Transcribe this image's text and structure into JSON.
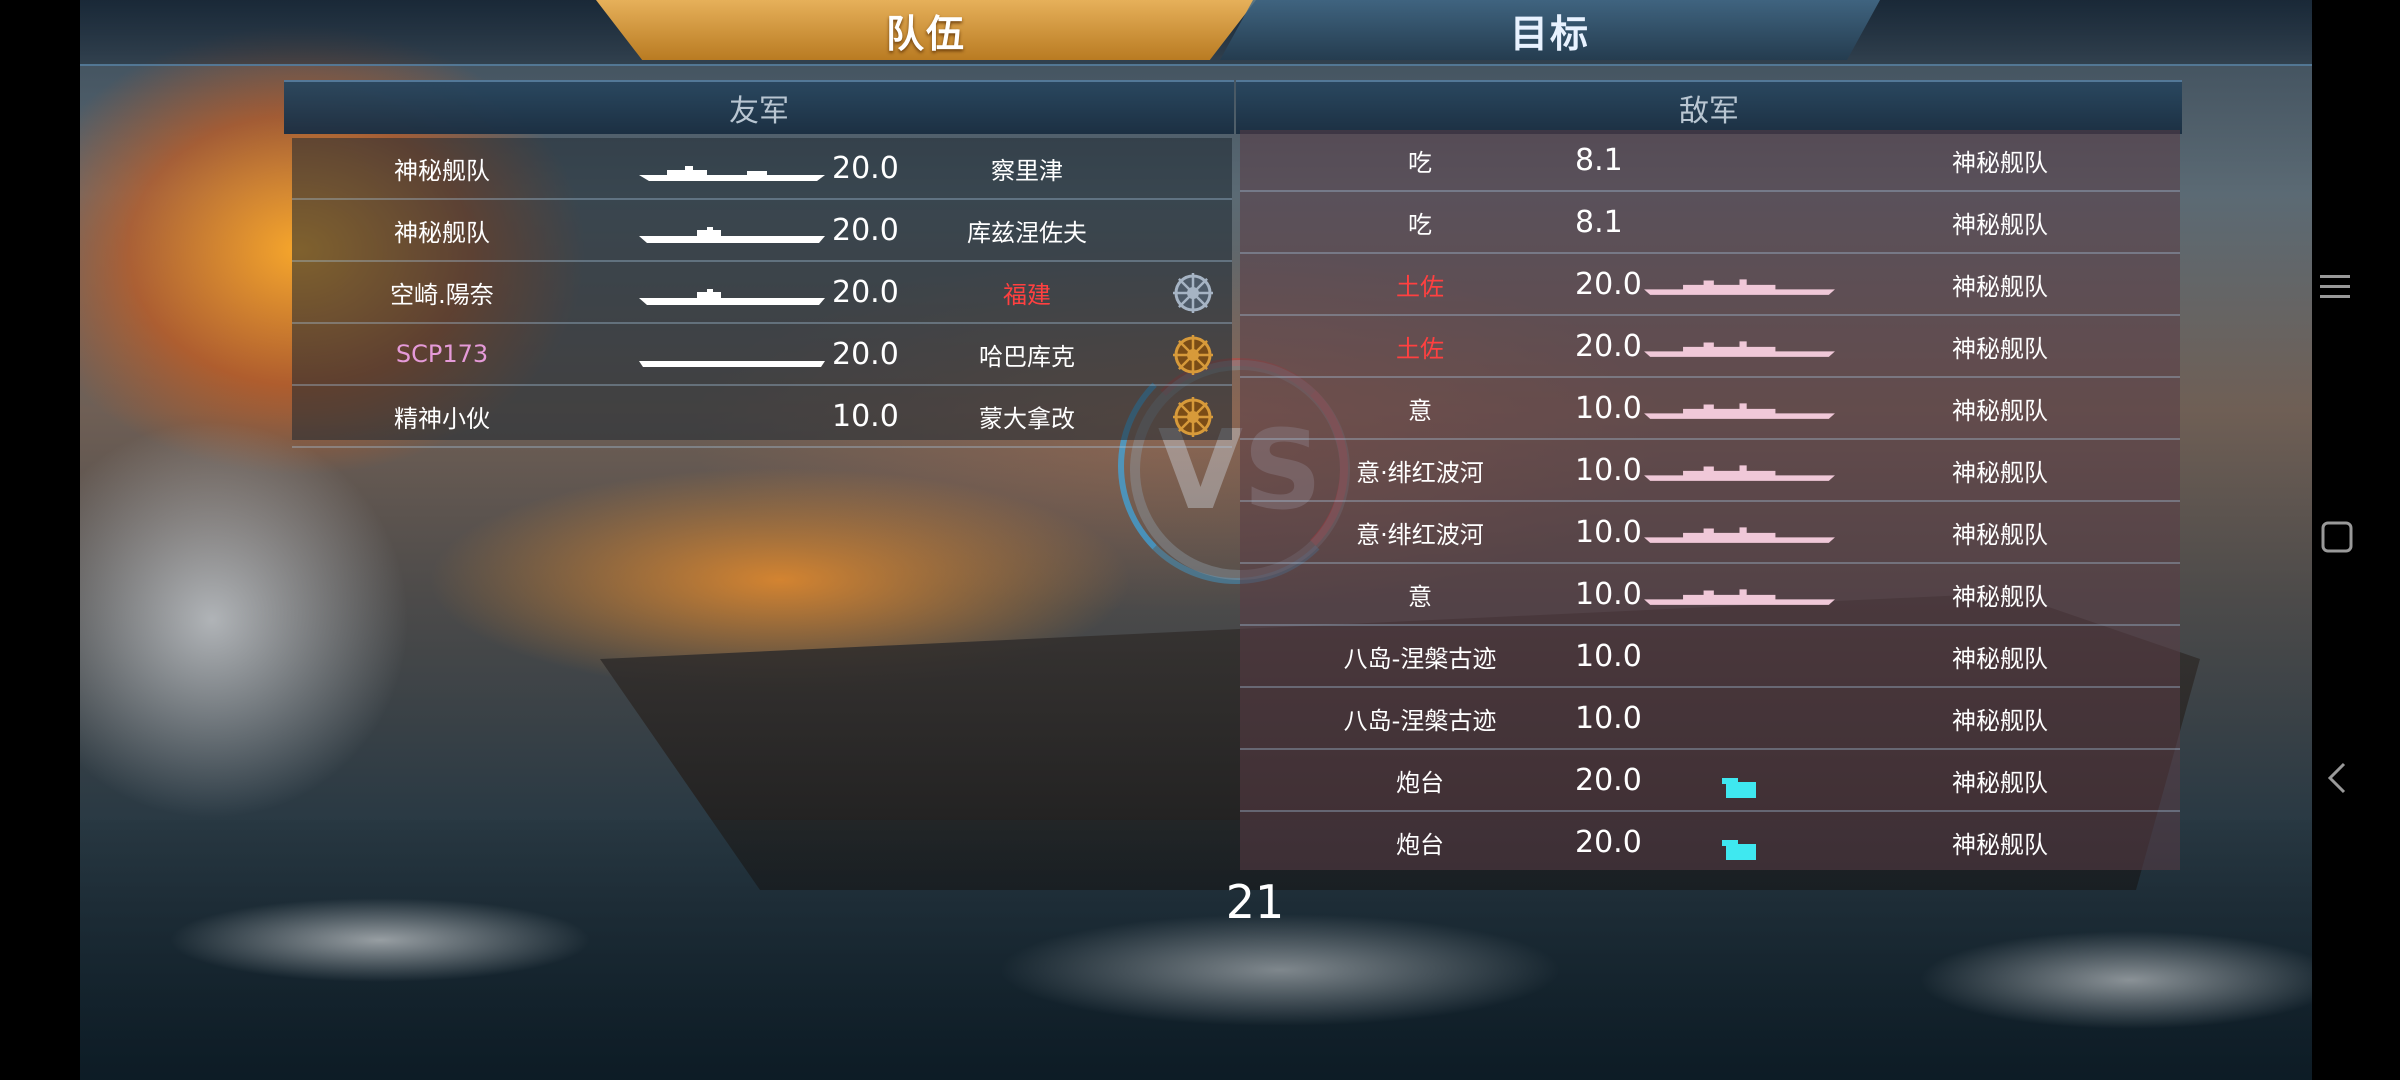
{
  "tabs": {
    "team": "队伍",
    "target": "目标"
  },
  "friendly": {
    "header": "友军",
    "rows": [
      {
        "name": "神秘舰队",
        "name_color": "#ffffff",
        "score": "20.0",
        "captain": "察里津",
        "captain_color": "#ffffff",
        "ship_icon": "destroyer-silhouette",
        "wheel": ""
      },
      {
        "name": "神秘舰队",
        "name_color": "#ffffff",
        "score": "20.0",
        "captain": "库兹涅佐夫",
        "captain_color": "#ffffff",
        "ship_icon": "carrier-silhouette",
        "wheel": ""
      },
      {
        "name": "空崎.陽奈",
        "name_color": "#ffffff",
        "score": "20.0",
        "captain": "福建",
        "captain_color": "#ff4040",
        "ship_icon": "carrier-silhouette",
        "wheel": "silver"
      },
      {
        "name": "SCP173",
        "name_color": "#e59ad8",
        "score": "20.0",
        "captain": "哈巴库克",
        "captain_color": "#ffffff",
        "ship_icon": "flat-carrier-silhouette",
        "wheel": "gold"
      },
      {
        "name": "精神小伙",
        "name_color": "#ffffff",
        "score": "10.0",
        "captain": "蒙大拿改",
        "captain_color": "#ffffff",
        "ship_icon": "",
        "wheel": "gold"
      }
    ]
  },
  "enemy": {
    "header": "敌军",
    "rows": [
      {
        "name": "吃",
        "name_color": "#ffffff",
        "score": "8.1",
        "fleet": "神秘舰队",
        "ship_icon": ""
      },
      {
        "name": "吃",
        "name_color": "#ffffff",
        "score": "8.1",
        "fleet": "神秘舰队",
        "ship_icon": ""
      },
      {
        "name": "土佐",
        "name_color": "#ff4040",
        "score": "20.0",
        "fleet": "神秘舰队",
        "ship_icon": "battleship-silhouette"
      },
      {
        "name": "土佐",
        "name_color": "#ff4040",
        "score": "20.0",
        "fleet": "神秘舰队",
        "ship_icon": "battleship-silhouette"
      },
      {
        "name": "意",
        "name_color": "#ffffff",
        "score": "10.0",
        "fleet": "神秘舰队",
        "ship_icon": "battleship-silhouette"
      },
      {
        "name": "意·绯红波河",
        "name_color": "#ffffff",
        "score": "10.0",
        "fleet": "神秘舰队",
        "ship_icon": "battleship-silhouette"
      },
      {
        "name": "意·绯红波河",
        "name_color": "#ffffff",
        "score": "10.0",
        "fleet": "神秘舰队",
        "ship_icon": "battleship-silhouette"
      },
      {
        "name": "意",
        "name_color": "#ffffff",
        "score": "10.0",
        "fleet": "神秘舰队",
        "ship_icon": "battleship-silhouette"
      },
      {
        "name": "八岛-涅槃古迹",
        "name_color": "#ffffff",
        "score": "10.0",
        "fleet": "神秘舰队",
        "ship_icon": ""
      },
      {
        "name": "八岛-涅槃古迹",
        "name_color": "#ffffff",
        "score": "10.0",
        "fleet": "神秘舰队",
        "ship_icon": ""
      },
      {
        "name": "炮台",
        "name_color": "#ffffff",
        "score": "20.0",
        "fleet": "神秘舰队",
        "ship_icon": "turret-icon"
      },
      {
        "name": "炮台",
        "name_color": "#ffffff",
        "score": "20.0",
        "fleet": "神秘舰队",
        "ship_icon": "turret-icon"
      }
    ]
  },
  "vs_label": "VS",
  "counter": "21",
  "colors": {
    "tab_active": "#d9a04a",
    "enemy_ship": "#f0c8d8",
    "friendly_ship": "#ffffff",
    "turret": "#3fe8f0",
    "red_name": "#ff4040",
    "pink_name": "#e59ad8"
  },
  "nav": {
    "menu_icon": "menu-icon",
    "home_icon": "square-home-icon",
    "back_icon": "back-chevron-icon"
  }
}
